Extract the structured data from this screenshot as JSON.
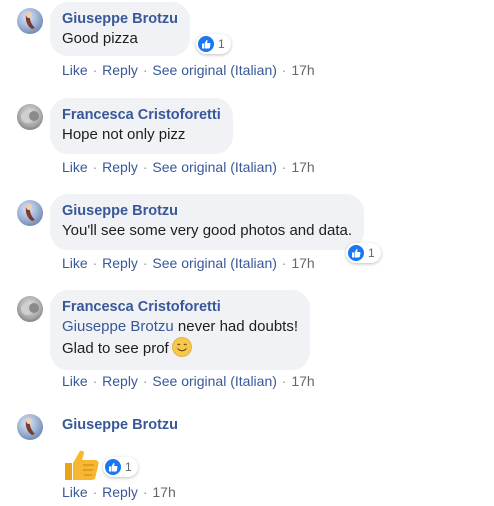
{
  "comments": [
    {
      "author": "Giuseppe Brotzu",
      "text": "Good pizza",
      "reaction_count": "1",
      "actions": {
        "like": "Like",
        "reply": "Reply",
        "see_original": "See original (Italian)",
        "time": "17h"
      }
    },
    {
      "author": "Francesca Cristoforetti",
      "text": "Hope not only pizz",
      "actions": {
        "like": "Like",
        "reply": "Reply",
        "see_original": "See original (Italian)",
        "time": "17h"
      }
    },
    {
      "author": "Giuseppe Brotzu",
      "text": "You'll see some very good photos and data.",
      "reaction_count": "1",
      "actions": {
        "like": "Like",
        "reply": "Reply",
        "see_original": "See original (Italian)",
        "time": "17h"
      }
    },
    {
      "author": "Francesca Cristoforetti",
      "mention": "Giuseppe Brotzu",
      "text_after_mention": " never had doubts!",
      "text_line2": "Glad to see prof",
      "emoji": "smiling-face-icon",
      "actions": {
        "like": "Like",
        "reply": "Reply",
        "see_original": "See original (Italian)",
        "time": "17h"
      }
    },
    {
      "author": "Giuseppe Brotzu",
      "sticker": "thumbs-up-icon",
      "reaction_count": "1",
      "actions": {
        "like": "Like",
        "reply": "Reply",
        "time": "17h"
      }
    }
  ],
  "colors": {
    "link": "#385898",
    "bubble": "#f0f2f5",
    "like_badge": "#1877f2",
    "meta": "#65676b"
  }
}
